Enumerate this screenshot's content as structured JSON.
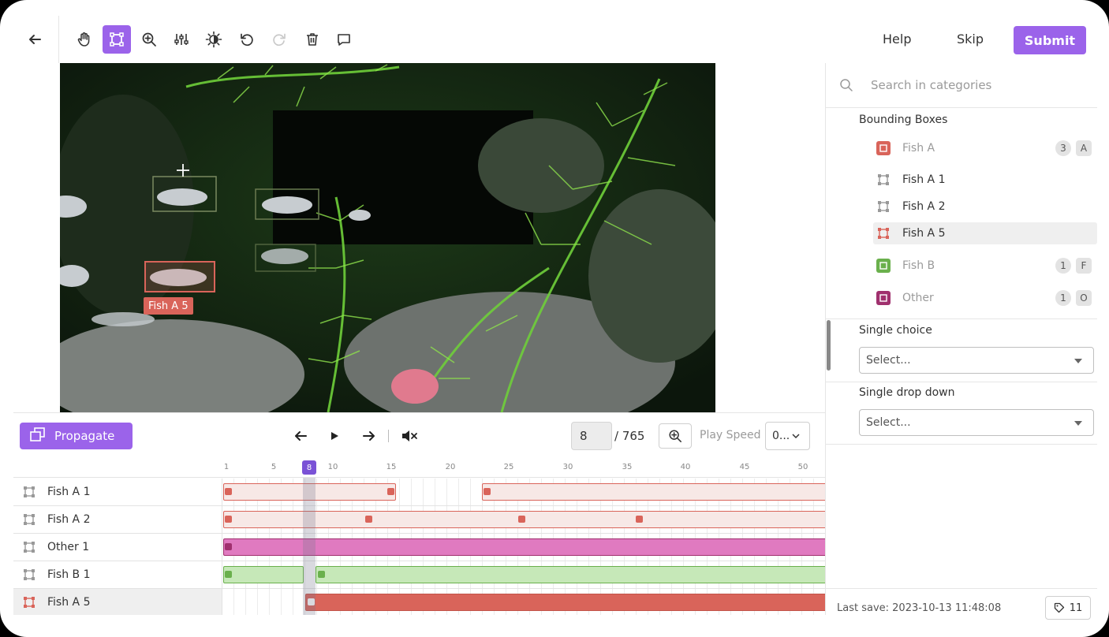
{
  "toolbar": {
    "tools": [
      {
        "name": "back-arrow-icon"
      },
      {
        "name": "hand-pan-icon"
      },
      {
        "name": "bounding-box-tool-icon",
        "active": true
      },
      {
        "name": "zoom-in-icon"
      },
      {
        "name": "sliders-icon"
      },
      {
        "name": "brightness-icon"
      },
      {
        "name": "undo-icon"
      },
      {
        "name": "redo-icon",
        "disabled": true
      },
      {
        "name": "trash-icon"
      },
      {
        "name": "comment-icon"
      }
    ],
    "help_label": "Help",
    "skip_label": "Skip",
    "submit_label": "Submit"
  },
  "canvas": {
    "selected_label": "Fish A 5"
  },
  "panel": {
    "search_placeholder": "Search in categories",
    "bounding_boxes_label": "Bounding Boxes",
    "categories": [
      {
        "label": "Fish A",
        "count": "3",
        "key": "A",
        "color": "#d9645a",
        "muted": true
      },
      {
        "label": "Fish A 1",
        "color": "#9a9a9a"
      },
      {
        "label": "Fish A 2",
        "color": "#9a9a9a"
      },
      {
        "label": "Fish A 5",
        "color": "#d9645a",
        "selected": true
      },
      {
        "label": "Fish B",
        "count": "1",
        "key": "F",
        "color": "#6ab04c",
        "muted": true
      },
      {
        "label": "Other",
        "count": "1",
        "key": "O",
        "color": "#a0306e",
        "muted": true
      }
    ],
    "single_choice_label": "Single choice",
    "single_choice_value": "Select...",
    "single_dropdown_label": "Single drop down",
    "single_dropdown_value": "Select...",
    "last_save": "Last save: 2023-10-13 11:48:08",
    "tag_count": "11"
  },
  "controls": {
    "propagate_label": "Propagate",
    "current_frame": "8",
    "total_frames": "/ 765",
    "play_speed_label": "Play Speed",
    "play_speed_value": "0..."
  },
  "timeline": {
    "ticks": [
      "1",
      "5",
      "10",
      "15",
      "20",
      "25",
      "30",
      "35",
      "40",
      "45",
      "50"
    ],
    "current": "8",
    "rows": [
      {
        "label": "Fish A 1",
        "color": "#d9645a"
      },
      {
        "label": "Fish A 2",
        "color": "#d9645a"
      },
      {
        "label": "Other 1",
        "color": "#a0306e"
      },
      {
        "label": "Fish B 1",
        "color": "#6ab04c"
      },
      {
        "label": "Fish A 5",
        "color": "#d9645a",
        "selected": true
      }
    ]
  },
  "colors": {
    "accent": "#9b63ea",
    "fish_a": "#d9645a",
    "fish_b": "#6ab04c",
    "other": "#a0306e"
  }
}
